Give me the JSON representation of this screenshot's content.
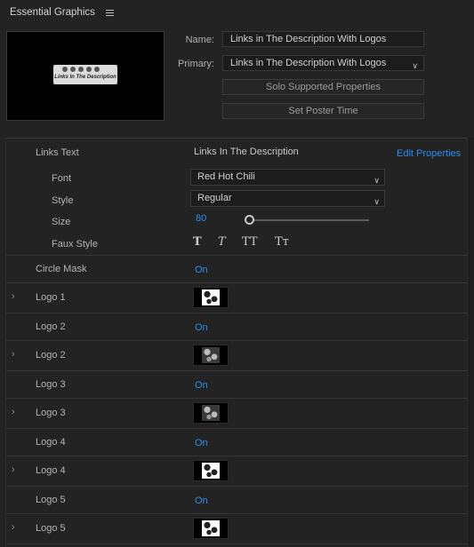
{
  "panel": {
    "title": "Essential Graphics",
    "menu_icon": "hamburger-menu-icon"
  },
  "poster": {
    "thumbnail_text": "Links In The Description"
  },
  "fields": {
    "name_label": "Name:",
    "name_value": "Links in The Description With Logos",
    "primary_label": "Primary:",
    "primary_value": "Links in The Description With Logos"
  },
  "buttons": {
    "solo": "Solo Supported Properties",
    "poster_time": "Set Poster Time"
  },
  "properties": {
    "links_text_label": "Links Text",
    "links_text_value": "Links In The Description",
    "edit_properties": "Edit Properties",
    "font_label": "Font",
    "font_value": "Red Hot Chili",
    "style_label": "Style",
    "style_value": "Regular",
    "size_label": "Size",
    "size_value": "80",
    "size_slider_fraction": 0.0,
    "faux_label": "Faux Style",
    "faux_buttons": [
      "T",
      "T",
      "TT",
      "Tт"
    ],
    "rows": [
      {
        "label": "Circle Mask",
        "value": "On"
      },
      {
        "label": "Logo 1",
        "thumb": "light"
      },
      {
        "label": "Logo 2",
        "value": "On"
      },
      {
        "label": "Logo 2",
        "thumb": "dark"
      },
      {
        "label": "Logo 3",
        "value": "On"
      },
      {
        "label": "Logo 3",
        "thumb": "dark"
      },
      {
        "label": "Logo 4",
        "value": "On"
      },
      {
        "label": "Logo 4",
        "thumb": "light"
      },
      {
        "label": "Logo 5",
        "value": "On"
      },
      {
        "label": "Logo 5",
        "thumb": "light"
      }
    ]
  },
  "colors": {
    "accent": "#2d8ceb",
    "background": "#232323"
  }
}
